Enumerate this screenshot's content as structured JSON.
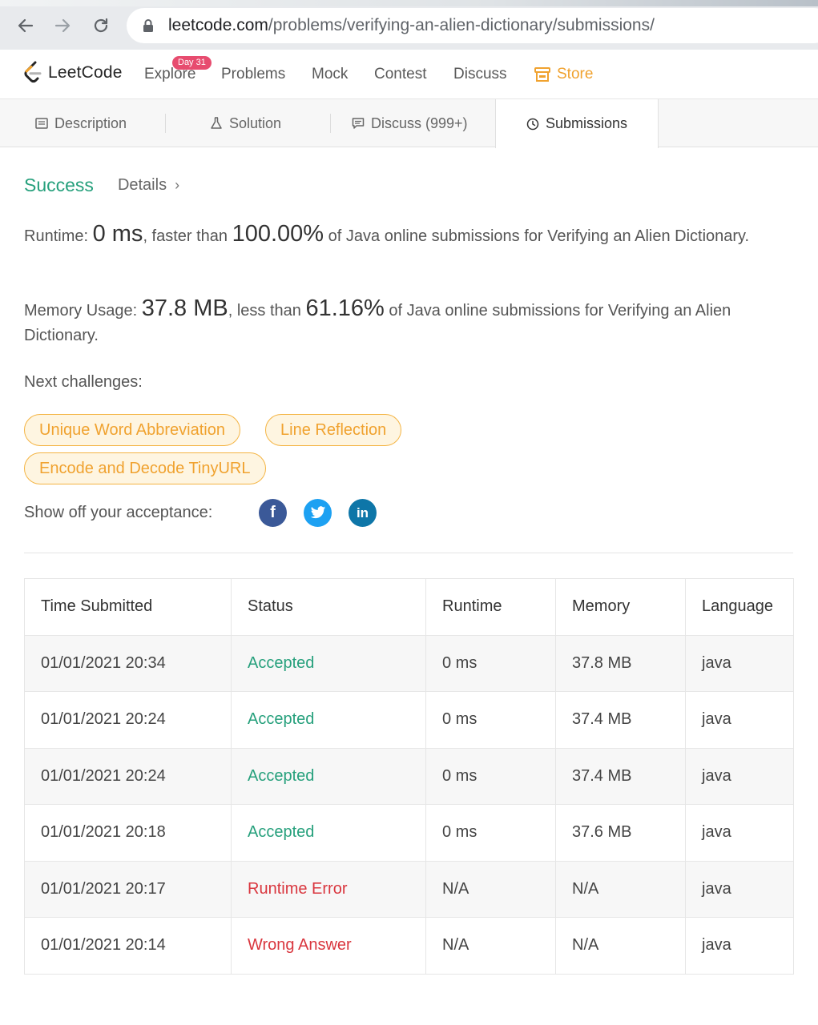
{
  "browser": {
    "url_host": "leetcode.com",
    "url_path": "/problems/verifying-an-alien-dictionary/submissions/"
  },
  "nav": {
    "logo_text": "LeetCode",
    "day_badge": "Day 31",
    "items": [
      "Explore",
      "Problems",
      "Mock",
      "Contest",
      "Discuss"
    ],
    "store_label": "Store"
  },
  "tabs": {
    "description": "Description",
    "solution": "Solution",
    "discuss": "Discuss (999+)",
    "submissions": "Submissions"
  },
  "result": {
    "status": "Success",
    "details": "Details",
    "runtime_prefix": "Runtime: ",
    "runtime_value": "0 ms",
    "runtime_mid": ", faster than ",
    "runtime_percent": "100.00%",
    "runtime_suffix": " of Java online submissions for Verifying an Alien Dictionary.",
    "memory_prefix": "Memory Usage: ",
    "memory_value": "37.8 MB",
    "memory_mid": ", less than ",
    "memory_percent": "61.16%",
    "memory_suffix": " of Java online submissions for Verifying an Alien Dictionary."
  },
  "next_challenges": {
    "label": "Next challenges:",
    "items": [
      "Unique Word Abbreviation",
      "Line Reflection",
      "Encode and Decode TinyURL"
    ]
  },
  "share": {
    "label": "Show off your acceptance:",
    "facebook": "f",
    "linkedin": "in"
  },
  "table": {
    "headers": [
      "Time Submitted",
      "Status",
      "Runtime",
      "Memory",
      "Language"
    ],
    "rows": [
      [
        "01/01/2021 20:34",
        "Accepted",
        "0 ms",
        "37.8 MB",
        "java"
      ],
      [
        "01/01/2021 20:24",
        "Accepted",
        "0 ms",
        "37.4 MB",
        "java"
      ],
      [
        "01/01/2021 20:24",
        "Accepted",
        "0 ms",
        "37.4 MB",
        "java"
      ],
      [
        "01/01/2021 20:18",
        "Accepted",
        "0 ms",
        "37.6 MB",
        "java"
      ],
      [
        "01/01/2021 20:17",
        "Runtime Error",
        "N/A",
        "N/A",
        "java"
      ],
      [
        "01/01/2021 20:14",
        "Wrong Answer",
        "N/A",
        "N/A",
        "java"
      ]
    ]
  },
  "colors": {
    "success": "#26a07c",
    "error": "#d9363e",
    "accent": "#f0a22f",
    "facebook": "#3b5998",
    "twitter": "#1da1f2",
    "linkedin": "#0e76a8"
  }
}
